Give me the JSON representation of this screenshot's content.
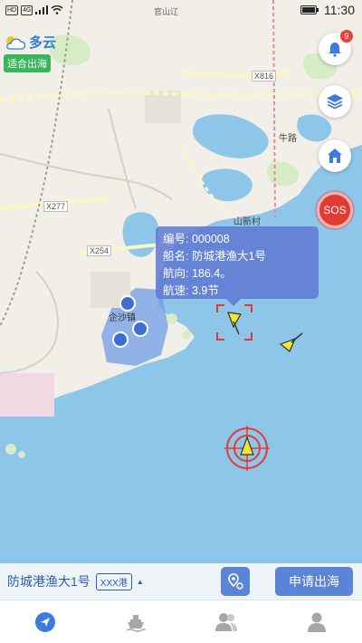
{
  "status_bar": {
    "network_badge_1": "HD",
    "network_badge_2": "4G",
    "time": "11:30"
  },
  "weather": {
    "icon": "partly-cloudy-icon",
    "condition": "多云",
    "advice": "适合出海"
  },
  "notifications": {
    "count": "9"
  },
  "sos": {
    "label": "SOS"
  },
  "map_labels": {
    "road_x816": "X816",
    "road_x277": "X277",
    "road_x254": "X254",
    "place_niulu": "牛路",
    "place_shanxincun": "山新村",
    "place_qisha": "企沙镇",
    "place_top": "官山辽"
  },
  "vessel_popup": {
    "id_label": "编号:",
    "id_value": "000008",
    "name_label": "船名:",
    "name_value": "防城港渔大1号",
    "heading_label": "航向:",
    "heading_value": "186.4。",
    "speed_label": "航速:",
    "speed_value": "3.9节"
  },
  "info_bar": {
    "vessel_name": "防城港渔大1号",
    "port_tag": "XXX港",
    "caret": "▲",
    "apply_label": "申请出海"
  },
  "tabs": [
    {
      "icon": "navigation-icon",
      "active": true
    },
    {
      "icon": "ship-icon",
      "active": false
    },
    {
      "icon": "contacts-icon",
      "active": false
    },
    {
      "icon": "profile-icon",
      "active": false
    }
  ],
  "colors": {
    "accent": "#5b83d6",
    "sea": "#8ec6ea",
    "land": "#f1efe7",
    "sos": "#e23b33",
    "weather_badge": "#3bb55c",
    "popup": "#5f78d2"
  }
}
